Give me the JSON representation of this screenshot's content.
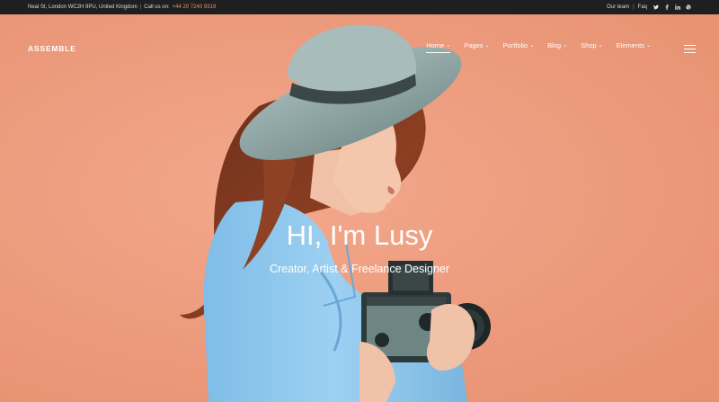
{
  "topbar": {
    "address": "Neal St, London WC2H 9PU, United Kingdom",
    "divider": "|",
    "call_label": "Call us on:",
    "phone": "+44 20 7240 9319",
    "our_team": "Our team",
    "faq": "Faq",
    "social_icons": [
      "twitter-icon",
      "facebook-icon",
      "linkedin-icon",
      "dribbble-icon"
    ]
  },
  "header": {
    "brand": "ASSEMBLE",
    "nav": [
      {
        "label": "Home",
        "active": true
      },
      {
        "label": "Pages"
      },
      {
        "label": "Portfolio"
      },
      {
        "label": "Blog"
      },
      {
        "label": "Shop"
      },
      {
        "label": "Elements"
      }
    ],
    "chevron": "⌄"
  },
  "hero": {
    "title": "HI, I'm Lusy",
    "subtitle": "Creator, Artist & Freelance Designer"
  },
  "colors": {
    "topbar_bg": "#1f1f1f",
    "hero_bg": "#ef9f83",
    "phone_accent": "#e8906f",
    "shirt": "#8cc6ec",
    "hat": "#8fa6a6"
  }
}
